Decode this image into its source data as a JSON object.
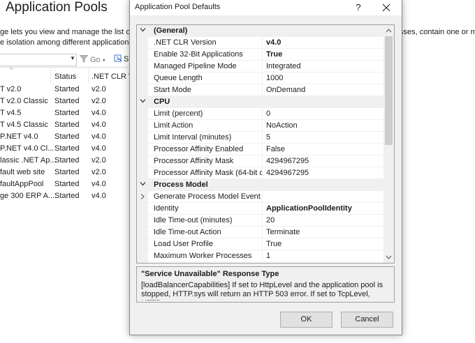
{
  "background_window": {
    "title": "Application Pools",
    "description_line1": "ge lets you view and manage the list of",
    "description_line2": "e isolation among different applications",
    "description_right": "sses, contain one or m",
    "filter": {
      "go_label": "Go",
      "show_all_label": "S"
    },
    "columns": [
      "",
      "Status",
      ".NET CLR V"
    ],
    "rows": [
      {
        "name": "T v2.0",
        "status": "Started",
        "clr": "v2.0"
      },
      {
        "name": "T v2.0 Classic",
        "status": "Started",
        "clr": "v2.0"
      },
      {
        "name": "T v4.5",
        "status": "Started",
        "clr": "v4.0"
      },
      {
        "name": "T v4.5 Classic",
        "status": "Started",
        "clr": "v4.0"
      },
      {
        "name": "P.NET v4.0",
        "status": "Started",
        "clr": "v4.0"
      },
      {
        "name": "P.NET v4.0 Cl...",
        "status": "Started",
        "clr": "v4.0"
      },
      {
        "name": "lassic .NET Ap...",
        "status": "Started",
        "clr": "v2.0"
      },
      {
        "name": "fault web site",
        "status": "Started",
        "clr": "v2.0"
      },
      {
        "name": "faultAppPool",
        "status": "Started",
        "clr": "v4.0"
      },
      {
        "name": "ge 300 ERP A...",
        "status": "Started",
        "clr": "v4.0"
      }
    ]
  },
  "dialog": {
    "title": "Application Pool Defaults",
    "help_label": "?",
    "property_grid": {
      "rows": [
        {
          "kind": "category",
          "label": "(General)",
          "expanded": true
        },
        {
          "kind": "property",
          "name": ".NET CLR Version",
          "value": "v4.0",
          "bold": true
        },
        {
          "kind": "property",
          "name": "Enable 32-Bit Applications",
          "value": "True",
          "bold": true
        },
        {
          "kind": "property",
          "name": "Managed Pipeline Mode",
          "value": "Integrated",
          "bold": false
        },
        {
          "kind": "property",
          "name": "Queue Length",
          "value": "1000",
          "bold": false
        },
        {
          "kind": "property",
          "name": "Start Mode",
          "value": "OnDemand",
          "bold": false
        },
        {
          "kind": "category",
          "label": "CPU",
          "expanded": true
        },
        {
          "kind": "property",
          "name": "Limit (percent)",
          "value": "0",
          "bold": false
        },
        {
          "kind": "property",
          "name": "Limit Action",
          "value": "NoAction",
          "bold": false
        },
        {
          "kind": "property",
          "name": "Limit Interval (minutes)",
          "value": "5",
          "bold": false
        },
        {
          "kind": "property",
          "name": "Processor Affinity Enabled",
          "value": "False",
          "bold": false
        },
        {
          "kind": "property",
          "name": "Processor Affinity Mask",
          "value": "4294967295",
          "bold": false
        },
        {
          "kind": "property",
          "name": "Processor Affinity Mask (64-bit c",
          "value": "4294967295",
          "bold": false
        },
        {
          "kind": "category",
          "label": "Process Model",
          "expanded": true
        },
        {
          "kind": "property",
          "name": "Generate Process Model Event L",
          "value": "",
          "bold": false,
          "expandable": true
        },
        {
          "kind": "property",
          "name": "Identity",
          "value": "ApplicationPoolIdentity",
          "bold": true
        },
        {
          "kind": "property",
          "name": "Idle Time-out (minutes)",
          "value": "20",
          "bold": false
        },
        {
          "kind": "property",
          "name": "Idle Time-out Action",
          "value": "Terminate",
          "bold": false
        },
        {
          "kind": "property",
          "name": "Load User Profile",
          "value": "True",
          "bold": false
        },
        {
          "kind": "property",
          "name": "Maximum Worker Processes",
          "value": "1",
          "bold": false
        }
      ]
    },
    "description": {
      "title": "\"Service Unavailable\" Response Type",
      "text": "[loadBalancerCapabilities] If set to HttpLevel and the application pool is stopped, HTTP.sys will return an HTTP 503 error.  If set to TcpLevel, HTTP.s..."
    },
    "buttons": {
      "ok": "OK",
      "cancel": "Cancel"
    }
  }
}
